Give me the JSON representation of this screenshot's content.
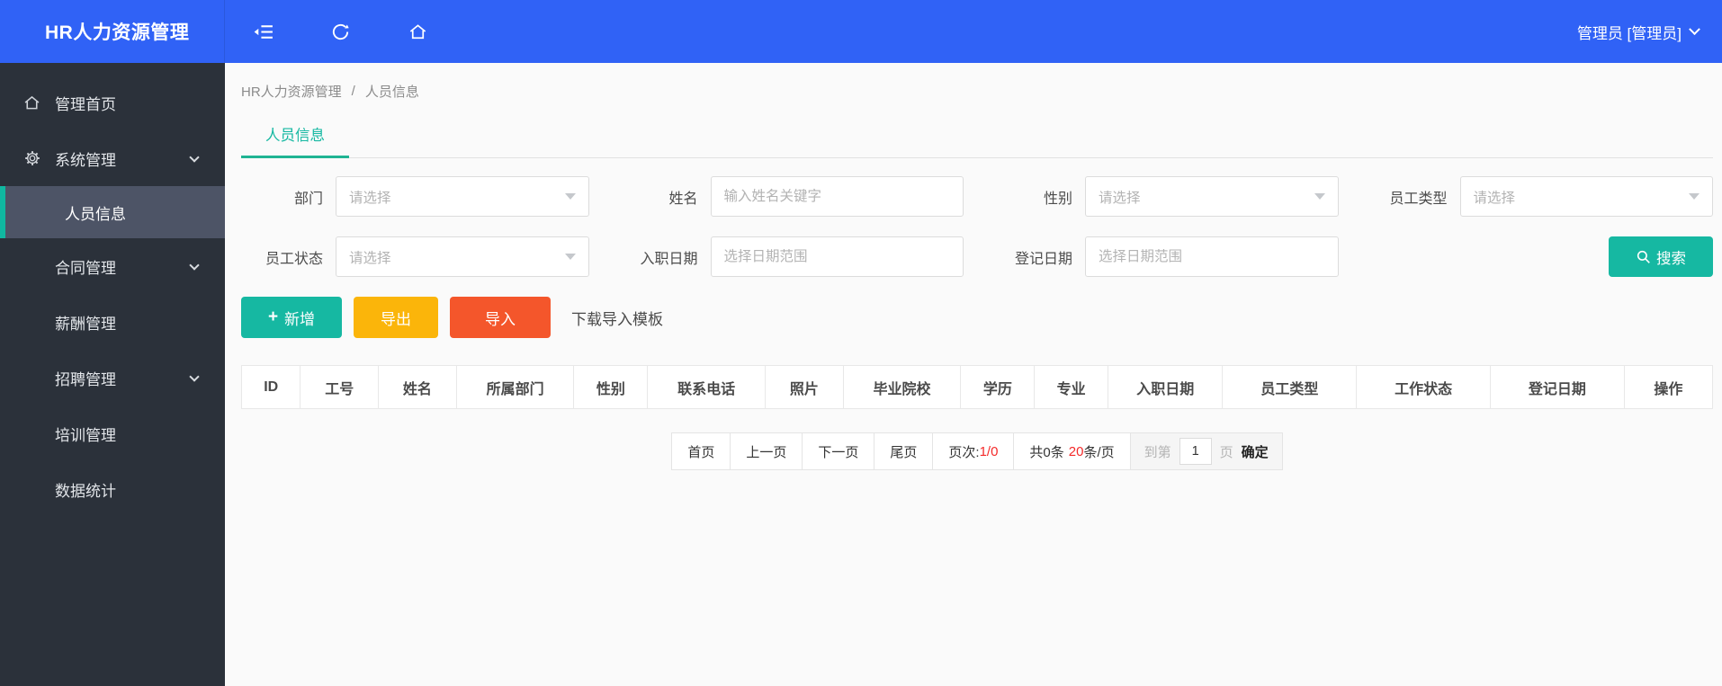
{
  "colors": {
    "header_blue": "#3062f6",
    "sidebar_dark": "#2b313a",
    "accent_teal": "#16b8a2",
    "export_yellow": "#fbb50a",
    "import_orange": "#f4562b",
    "highlight_red": "#f42a2a"
  },
  "header": {
    "title": "HR人力资源管理",
    "user": "管理员 [管理员]",
    "icons": [
      "collapse-menu-icon",
      "refresh-icon",
      "home-icon",
      "chevron-down-icon"
    ]
  },
  "sidebar": {
    "items": [
      {
        "label": "管理首页",
        "icon": "home-icon"
      },
      {
        "label": "系统管理",
        "icon": "gear-icon",
        "expandable": true
      },
      {
        "label": "人员信息",
        "submenu": true,
        "active": true
      },
      {
        "label": "合同管理",
        "expandable": true
      },
      {
        "label": "薪酬管理"
      },
      {
        "label": "招聘管理",
        "expandable": true
      },
      {
        "label": "培训管理"
      },
      {
        "label": "数据统计"
      }
    ]
  },
  "breadcrumb": {
    "root": "HR人力资源管理",
    "separator": "/",
    "current": "人员信息"
  },
  "tabs": {
    "active": "人员信息"
  },
  "filters": {
    "row1": [
      {
        "label": "部门",
        "placeholder": "请选择"
      },
      {
        "label": "姓名",
        "placeholder": "输入姓名关键字"
      },
      {
        "label": "性别",
        "placeholder": "请选择"
      },
      {
        "label": "员工类型",
        "placeholder": "请选择"
      }
    ],
    "row2": [
      {
        "label": "员工状态",
        "placeholder": "请选择"
      },
      {
        "label": "入职日期",
        "placeholder": "选择日期范围"
      },
      {
        "label": "登记日期",
        "placeholder": "选择日期范围"
      }
    ],
    "search_label": "搜索"
  },
  "toolbar": {
    "add_icon": "+",
    "add_label": "新增",
    "export_label": "导出",
    "import_label": "导入",
    "template_label": "下载导入模板"
  },
  "table": {
    "columns": [
      "ID",
      "工号",
      "姓名",
      "所属部门",
      "性别",
      "联系电话",
      "照片",
      "毕业院校",
      "学历",
      "专业",
      "入职日期",
      "员工类型",
      "工作状态",
      "登记日期",
      "操作"
    ]
  },
  "pagination": {
    "first": "首页",
    "prev": "上一页",
    "next": "下一页",
    "last": "尾页",
    "page_label": "页次:",
    "page_value": "1/0",
    "total_label": "共0条",
    "per_page_value": "20",
    "per_page_unit": "条/页",
    "goto_label": "到第",
    "goto_value": "1",
    "goto_unit": "页",
    "confirm_label": "确定"
  }
}
